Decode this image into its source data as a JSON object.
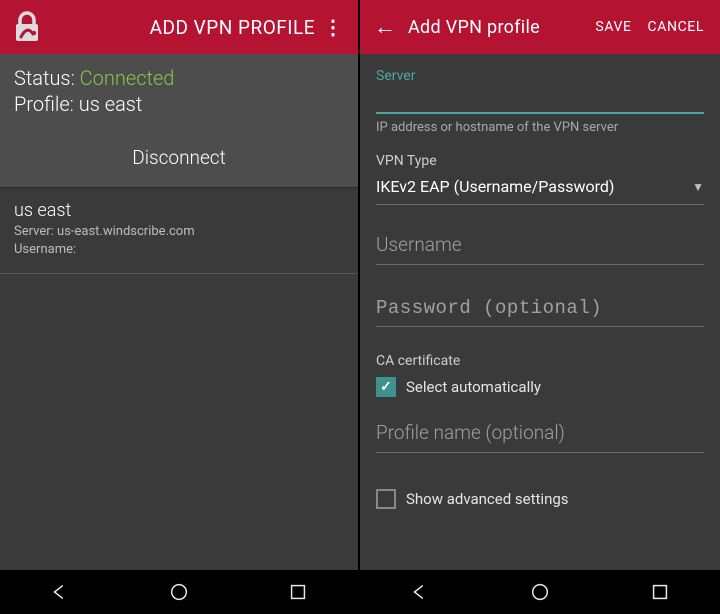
{
  "left": {
    "appbar_title": "ADD VPN PROFILE",
    "status_label": "Status:",
    "status_value": "Connected",
    "profile_label": "Profile:",
    "profile_value": "us east",
    "disconnect": "Disconnect",
    "profile": {
      "name": "us east",
      "server_label": "Server:",
      "server_value": "us-east.windscribe.com",
      "username_label": "Username:",
      "username_value": ""
    }
  },
  "right": {
    "appbar_title": "Add VPN profile",
    "save": "SAVE",
    "cancel": "CANCEL",
    "server_label": "Server",
    "server_hint": "IP address or hostname of the VPN server",
    "vpntype_label": "VPN Type",
    "vpntype_value": "IKEv2 EAP (Username/Password)",
    "username_placeholder": "Username",
    "password_placeholder": "Password (optional)",
    "ca_label": "CA certificate",
    "ca_auto": "Select automatically",
    "profile_name_placeholder": "Profile name (optional)",
    "show_advanced": "Show advanced settings"
  }
}
